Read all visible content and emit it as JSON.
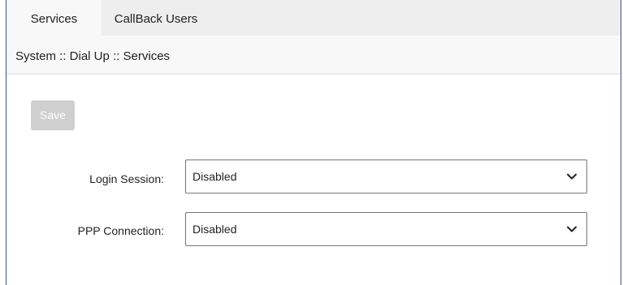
{
  "tabs": [
    {
      "label": "Services",
      "active": true
    },
    {
      "label": "CallBack Users",
      "active": false
    }
  ],
  "breadcrumb": "System :: Dial Up :: Services",
  "toolbar": {
    "save_label": "Save"
  },
  "form": {
    "login_session": {
      "label": "Login Session:",
      "value": "Disabled"
    },
    "ppp_connection": {
      "label": "PPP Connection:",
      "value": "Disabled"
    }
  },
  "colors": {
    "tab_bar_bg": "#eeeeee",
    "active_tab_bg": "#f8f8f8",
    "save_button_disabled_bg": "#cfcfcf",
    "frame_border": "#3c4f7a"
  }
}
